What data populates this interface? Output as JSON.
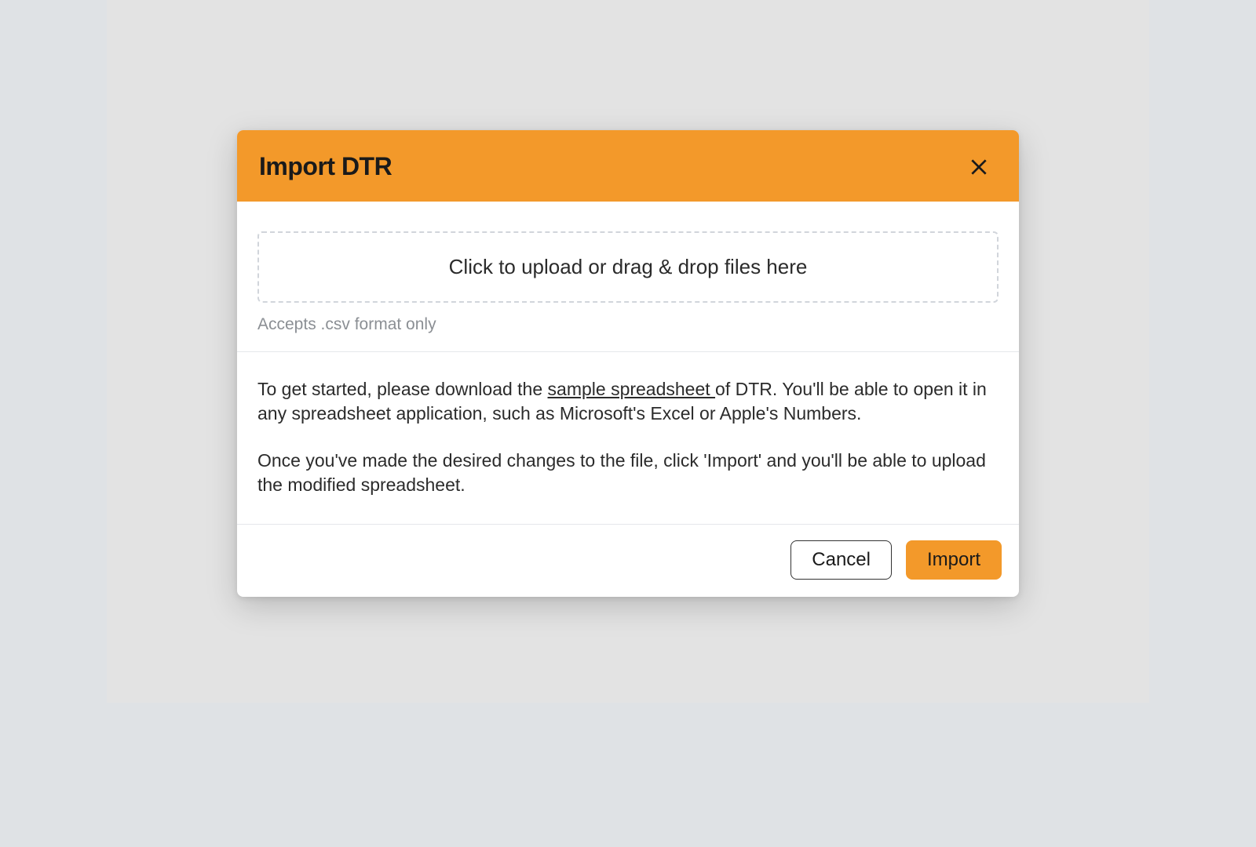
{
  "modal": {
    "title": "Import DTR",
    "dropzone_text": "Click to upload or drag & drop files here",
    "accepts_hint": "Accepts .csv format only",
    "instructions": {
      "para1_pre": "To get started, please download the ",
      "sample_link_text": "sample spreadsheet ",
      "para1_post": "of DTR. You'll be able to open it in any spreadsheet application, such as Microsoft's Excel or Apple's Numbers.",
      "para2": "Once you've made the desired changes to the file, click 'Import' and you'll be able to upload the modified spreadsheet."
    },
    "buttons": {
      "cancel": "Cancel",
      "import": "Import"
    }
  }
}
